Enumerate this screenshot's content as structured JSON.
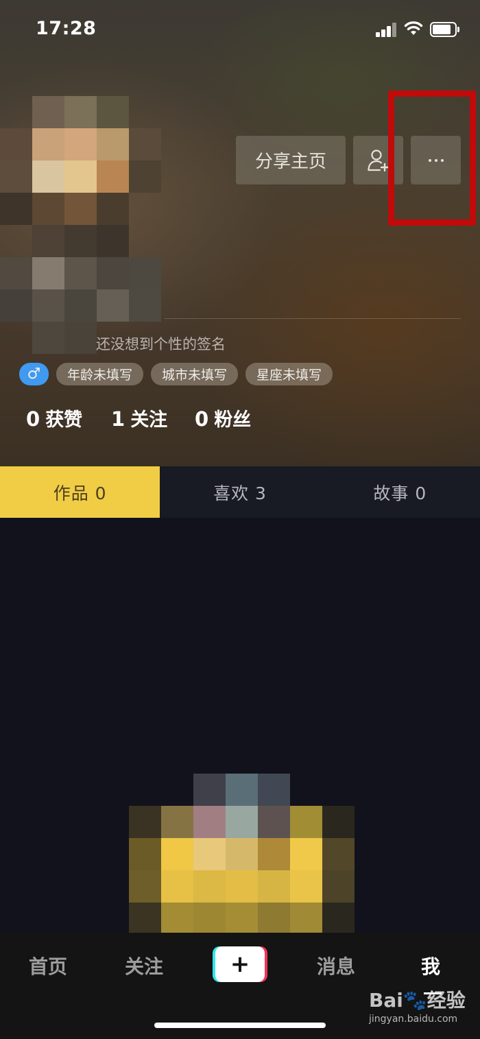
{
  "status_bar": {
    "time": "17:28"
  },
  "header": {
    "share_label": "分享主页",
    "signature": "还没想到个性的签名",
    "tags": {
      "gender": "♂",
      "age": "年龄未填写",
      "city": "城市未填写",
      "constellation": "星座未填写"
    },
    "stats": {
      "likes": {
        "value": "0",
        "label": "获赞"
      },
      "following": {
        "value": "1",
        "label": "关注"
      },
      "fans": {
        "value": "0",
        "label": "粉丝"
      }
    }
  },
  "tabs": [
    {
      "label": "作品 0",
      "active": true
    },
    {
      "label": "喜欢 3",
      "active": false
    },
    {
      "label": "故事 0",
      "active": false
    }
  ],
  "bottom_nav": {
    "home": "首页",
    "follow": "关注",
    "create": "+",
    "messages": "消息",
    "me": "我"
  },
  "watermark": {
    "brand": "Bai🐾经验",
    "url": "jingyan.baidu.com"
  },
  "colors": {
    "accent_yellow": "#f1cc45",
    "gender_blue": "#3f9af0",
    "highlight_red": "#c10a0a",
    "create_cyan": "#35e6e6",
    "create_red": "#f0355a"
  }
}
